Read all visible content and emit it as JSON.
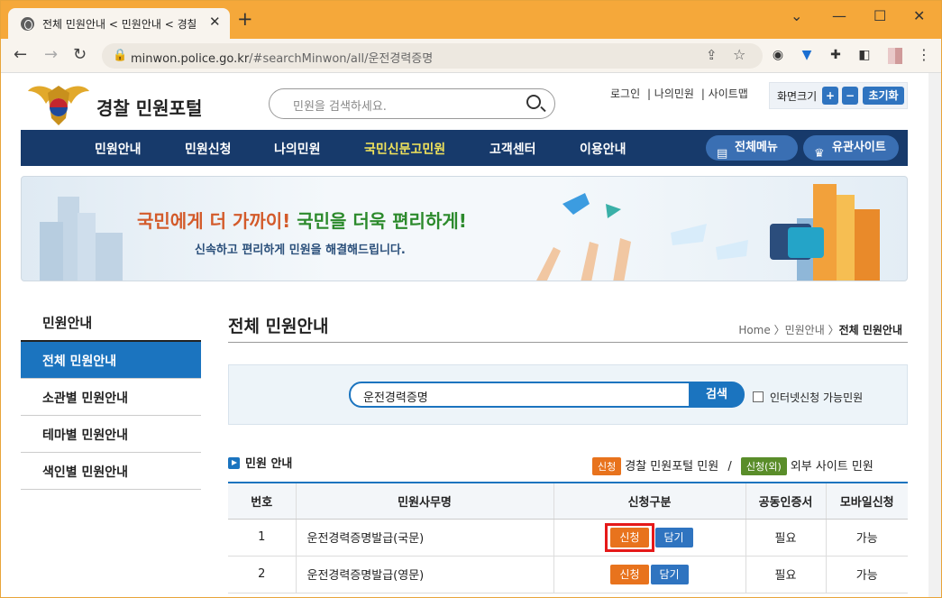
{
  "browser": {
    "tab_title": "전체 민원안내 < 민원안내 < 경찰",
    "new_tab": "+",
    "url_host": "minwon.police.go.kr",
    "url_path": "/#searchMinwon/all/운전경력증명"
  },
  "site": {
    "name": "경찰 민원포털",
    "search_placeholder": "민원을 검색하세요.",
    "top_links": [
      "로그인",
      "| 나의민원",
      "| 사이트맵"
    ],
    "zoom_label": "화면크기",
    "zoom_in": "+",
    "zoom_out": "−",
    "zoom_reset": "초기화"
  },
  "gnb": {
    "items": [
      "민원안내",
      "민원신청",
      "나의민원",
      "국민신문고민원",
      "고객센터",
      "이용안내"
    ],
    "all_menu": "전체메뉴",
    "related_sites": "유관사이트"
  },
  "banner": {
    "headline_a": "국민에게 더 가까이!",
    "headline_b": "국민을 더욱 편리하게!",
    "sub": "신속하고 편리하게 민원을 해결해드립니다."
  },
  "lnb": {
    "head": "민원안내",
    "items": [
      "전체 민원안내",
      "소관별 민원안내",
      "테마별 민원안내",
      "색인별 민원안내"
    ]
  },
  "content": {
    "title": "전체 민원안내",
    "crumb_home": "Home",
    "crumb_mid": "민원안내",
    "crumb_cur": "전체 민원안내",
    "search_value": "운전경력증명",
    "search_btn": "검색",
    "checkbox_label": "인터넷신청 가능민원",
    "section": "민원 안내",
    "legend_tag1": "신청",
    "legend_text1": "경찰 민원포털 민원",
    "legend_sep": "/",
    "legend_tag2": "신청(외)",
    "legend_text2": "외부 사이트 민원"
  },
  "table": {
    "headers": [
      "번호",
      "민원사무명",
      "신청구분",
      "공동인증서",
      "모바일신청"
    ],
    "rows": [
      {
        "no": "1",
        "name": "운전경력증명발급(국문)",
        "apply": "신청",
        "save": "담기",
        "cert": "필요",
        "mobile": "가능"
      },
      {
        "no": "2",
        "name": "운전경력증명발급(영문)",
        "apply": "신청",
        "save": "담기",
        "cert": "필요",
        "mobile": "가능"
      }
    ]
  }
}
